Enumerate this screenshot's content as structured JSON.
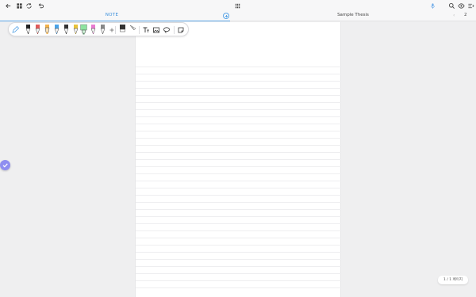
{
  "tabs": {
    "note_label": "NOTE",
    "document_title": "Sample Thesis",
    "document_page_number": "2"
  },
  "page_indicator": "1 / 1 페이지",
  "toolbar_icons": [
    "back-arrow-icon",
    "grid-icon",
    "sync-icon",
    "undo-icon",
    "apps-icon",
    "mic-icon",
    "search-icon",
    "eye-icon",
    "menu-icon"
  ],
  "palette": {
    "tools": [
      "pen-black",
      "pen-red",
      "highlighter-orange",
      "marker-blue",
      "pen-black-2",
      "marker-yellow",
      "highlighter-green",
      "marker-pink",
      "pen-gray"
    ],
    "colors": {
      "accent": "#3b8fdc",
      "pen_red": "#e05a5a",
      "highlight_orange": "#f2b14a",
      "marker_blue": "#4aa3e8",
      "marker_yellow": "#e8c33a",
      "highlight_green": "#8ee3a0",
      "marker_pink": "#e97bd0",
      "float_button": "#8f8ef0"
    }
  }
}
